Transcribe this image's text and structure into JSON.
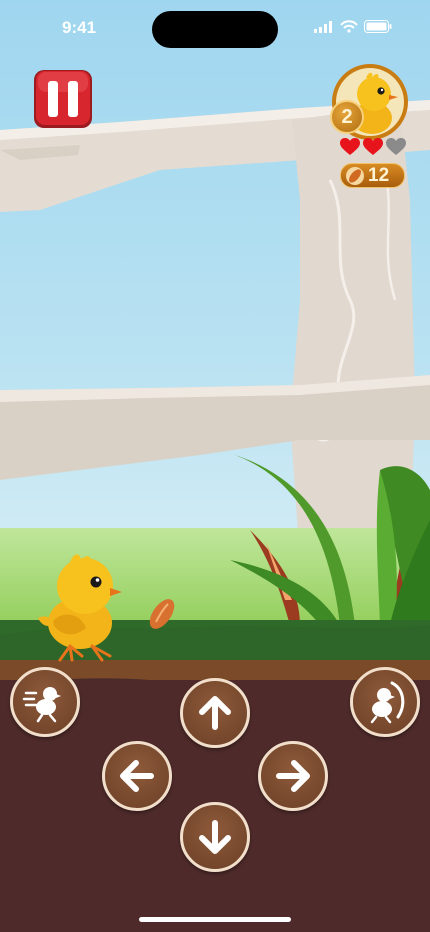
{
  "status_bar": {
    "time": "9:41"
  },
  "hud": {
    "level": "2",
    "hearts": {
      "filled": 2,
      "total": 3
    },
    "seed_count": "12"
  },
  "colors": {
    "heart_full": "#e8141c",
    "heart_empty": "#8a8a8a",
    "pause_red": "#d8262e",
    "control_brown": "#7a4a2e"
  },
  "controls": [
    {
      "name": "dash-button",
      "icon": "running-chick-icon"
    },
    {
      "name": "up-button",
      "icon": "arrow-up-icon"
    },
    {
      "name": "jump-flap-button",
      "icon": "flapping-chick-icon"
    },
    {
      "name": "left-button",
      "icon": "arrow-left-icon"
    },
    {
      "name": "right-button",
      "icon": "arrow-right-icon"
    },
    {
      "name": "down-button",
      "icon": "arrow-down-icon"
    }
  ]
}
